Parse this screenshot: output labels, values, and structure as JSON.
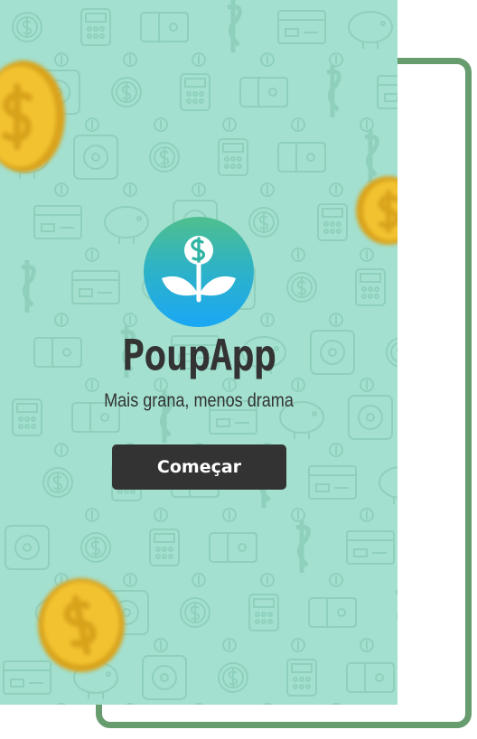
{
  "app": {
    "name": "PoupApp",
    "tagline": "Mais grana, menos drama",
    "logo_icon": "money-plant-icon",
    "start_button_label": "Começar"
  },
  "decor": {
    "background_pattern": "finance-doodle-pattern",
    "coin_icon": "dollar-coin-icon"
  },
  "colors": {
    "screen_bg": "#a3e0cf",
    "frame": "#679c6f",
    "button_bg": "#333333",
    "text": "#333333",
    "coin": "#f0c02a",
    "logo_gradient_top": "#4fbf8d",
    "logo_gradient_bottom": "#1aa7f5"
  }
}
